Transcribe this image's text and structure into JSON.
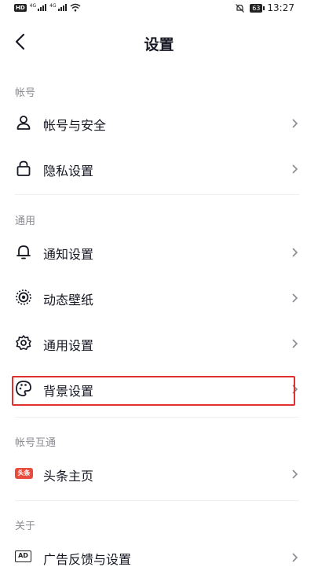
{
  "status_bar": {
    "hd": "HD",
    "net1": "4G",
    "net2": "4G",
    "battery": "63",
    "time": "13:27"
  },
  "header": {
    "title": "设置"
  },
  "sections": {
    "account": {
      "label": "帐号",
      "items": [
        {
          "label": "帐号与安全",
          "icon": "user-icon"
        },
        {
          "label": "隐私设置",
          "icon": "lock-icon"
        }
      ]
    },
    "general": {
      "label": "通用",
      "items": [
        {
          "label": "通知设置",
          "icon": "bell-icon"
        },
        {
          "label": "动态壁纸",
          "icon": "live-wallpaper-icon"
        },
        {
          "label": "通用设置",
          "icon": "gear-icon"
        },
        {
          "label": "背景设置",
          "icon": "palette-icon"
        }
      ]
    },
    "linked": {
      "label": "帐号互通",
      "items": [
        {
          "label": "头条主页",
          "icon": "toutiao-icon",
          "badge": "头条"
        }
      ]
    },
    "about": {
      "label": "关于",
      "items": [
        {
          "label": "广告反馈与设置",
          "icon": "ad-icon",
          "badge": "AD"
        }
      ]
    }
  },
  "colors": {
    "highlight": "#e0312f",
    "section_label": "#8a8b91",
    "text": "#161823"
  }
}
